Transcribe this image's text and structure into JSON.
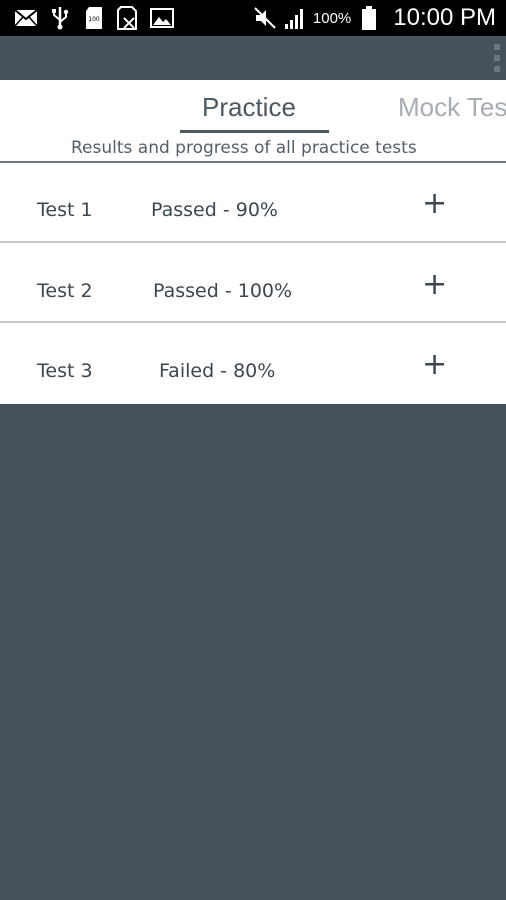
{
  "status_bar": {
    "icons_left": [
      "mail-icon",
      "usb-icon",
      "sd-card-icon",
      "no-sim-icon",
      "image-icon"
    ],
    "signal_percent": "100%",
    "time": "10:00 PM"
  },
  "tabs": [
    {
      "label": "Practice",
      "active": true
    },
    {
      "label": "Mock Tes",
      "active": false
    }
  ],
  "subtitle": "Results and progress of all practice tests",
  "tests": [
    {
      "name": "Test 1",
      "status": "Passed - 90%",
      "expand": "+"
    },
    {
      "name": "Test 2",
      "status": "Passed - 100%",
      "expand": "+"
    },
    {
      "name": "Test 3",
      "status": "Failed - 80%",
      "expand": "+"
    }
  ],
  "colors": {
    "background": "#45515b",
    "panel": "#ffffff",
    "active_tab": "#4c5862",
    "inactive_tab": "#a6adb3",
    "text": "#3c4750"
  }
}
